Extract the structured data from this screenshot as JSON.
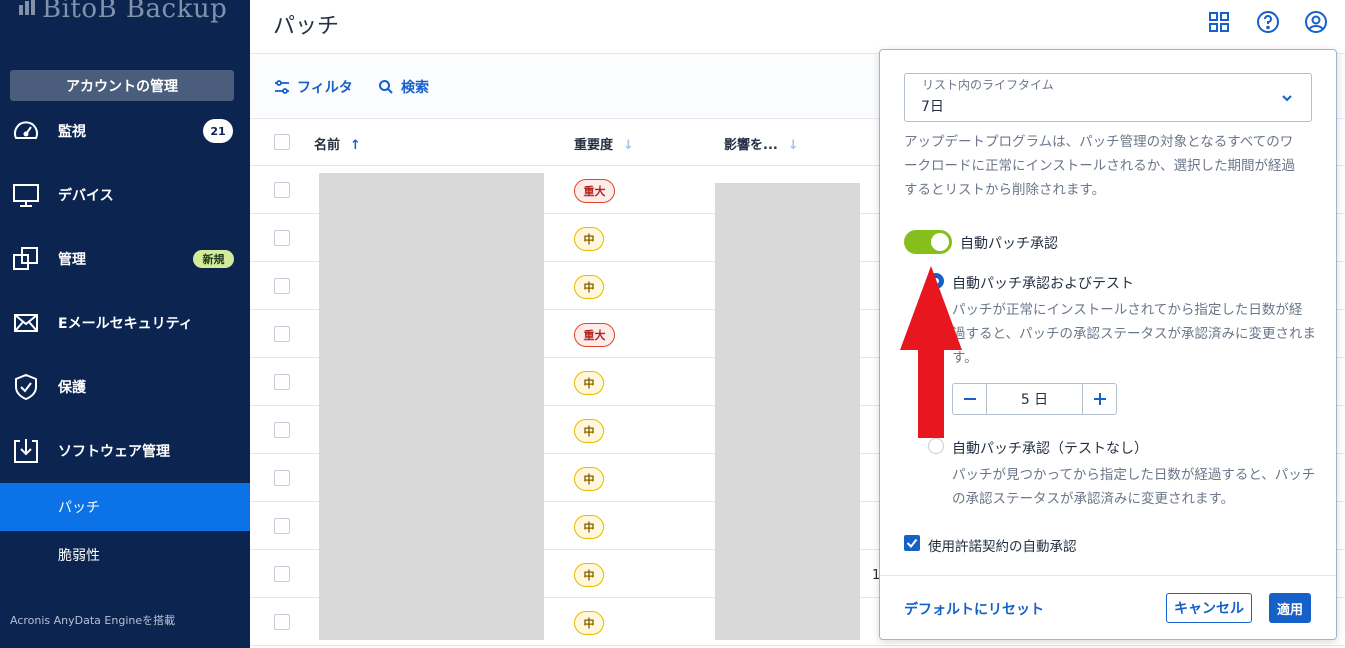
{
  "app": {
    "logo_text": "BitoB Backup"
  },
  "sidebar": {
    "account_button": "アカウントの管理",
    "items": [
      {
        "label": "監視",
        "badge": "21",
        "icon": "gauge-icon"
      },
      {
        "label": "デバイス",
        "icon": "monitor-icon"
      },
      {
        "label": "管理",
        "badge": "新規",
        "icon": "stack-icon"
      },
      {
        "label": "Eメールセキュリティ",
        "icon": "mail-icon"
      },
      {
        "label": "保護",
        "icon": "shield-icon"
      },
      {
        "label": "ソフトウェア管理",
        "icon": "download-box-icon"
      }
    ],
    "subitems": [
      {
        "label": "パッチ",
        "active": true
      },
      {
        "label": "脆弱性",
        "active": false
      }
    ],
    "footer": "Acronis AnyData Engineを搭載"
  },
  "header": {
    "title": "パッチ",
    "icons": [
      "grid-icon",
      "help-icon",
      "user-icon"
    ]
  },
  "toolbar": {
    "filter_label": "フィルタ",
    "search_label": "検索"
  },
  "table": {
    "columns": [
      "名前",
      "重要度",
      "影響を..."
    ],
    "sort_arrows": [
      "↑",
      "↓",
      "↓"
    ],
    "rows": [
      {
        "severity": "重大",
        "level": "critical"
      },
      {
        "severity": "中",
        "level": "medium"
      },
      {
        "severity": "中",
        "level": "medium"
      },
      {
        "severity": "重大",
        "level": "critical"
      },
      {
        "severity": "中",
        "level": "medium"
      },
      {
        "severity": "中",
        "level": "medium"
      },
      {
        "severity": "中",
        "level": "medium"
      },
      {
        "severity": "中",
        "level": "medium"
      },
      {
        "severity": "中",
        "level": "medium"
      },
      {
        "severity": "中",
        "level": "medium"
      }
    ],
    "row_peek_text": "1"
  },
  "panel": {
    "lifetime_label": "リスト内のライフタイム",
    "lifetime_value": "7日",
    "lifetime_desc_1": "アップデートプログラムは、パッチ管理の対象となるすべてのワ",
    "lifetime_desc_2": "ークロードに正常にインストールされるか、選択した期間が経過",
    "lifetime_desc_3": "するとリストから削除されます。",
    "auto_approve_label": "自動パッチ承認",
    "auto_approve_on": true,
    "option_test_label": "自動パッチ承認およびテスト",
    "option_test_desc_1": "パッチが正常にインストールされてから指定した日数が経",
    "option_test_desc_2": "過すると、パッチの承認ステータスが承認済みに変更されま",
    "option_test_desc_3": "す。",
    "stepper_value": "5 日",
    "option_notest_label": "自動パッチ承認（テストなし）",
    "option_notest_desc_1": "パッチが見つかってから指定した日数が経過すると、パッチ",
    "option_notest_desc_2": "の承認ステータスが承認済みに変更されます。",
    "eula_label": "使用許諾契約の自動承認",
    "eula_checked": true,
    "reset_label": "デフォルトにリセット",
    "cancel_label": "キャンセル",
    "apply_label": "適用"
  },
  "colors": {
    "sidebar_bg": "#0b2550",
    "accent": "#1560c9",
    "toggle_on": "#86be1c",
    "annotation_arrow": "#e8161e"
  }
}
